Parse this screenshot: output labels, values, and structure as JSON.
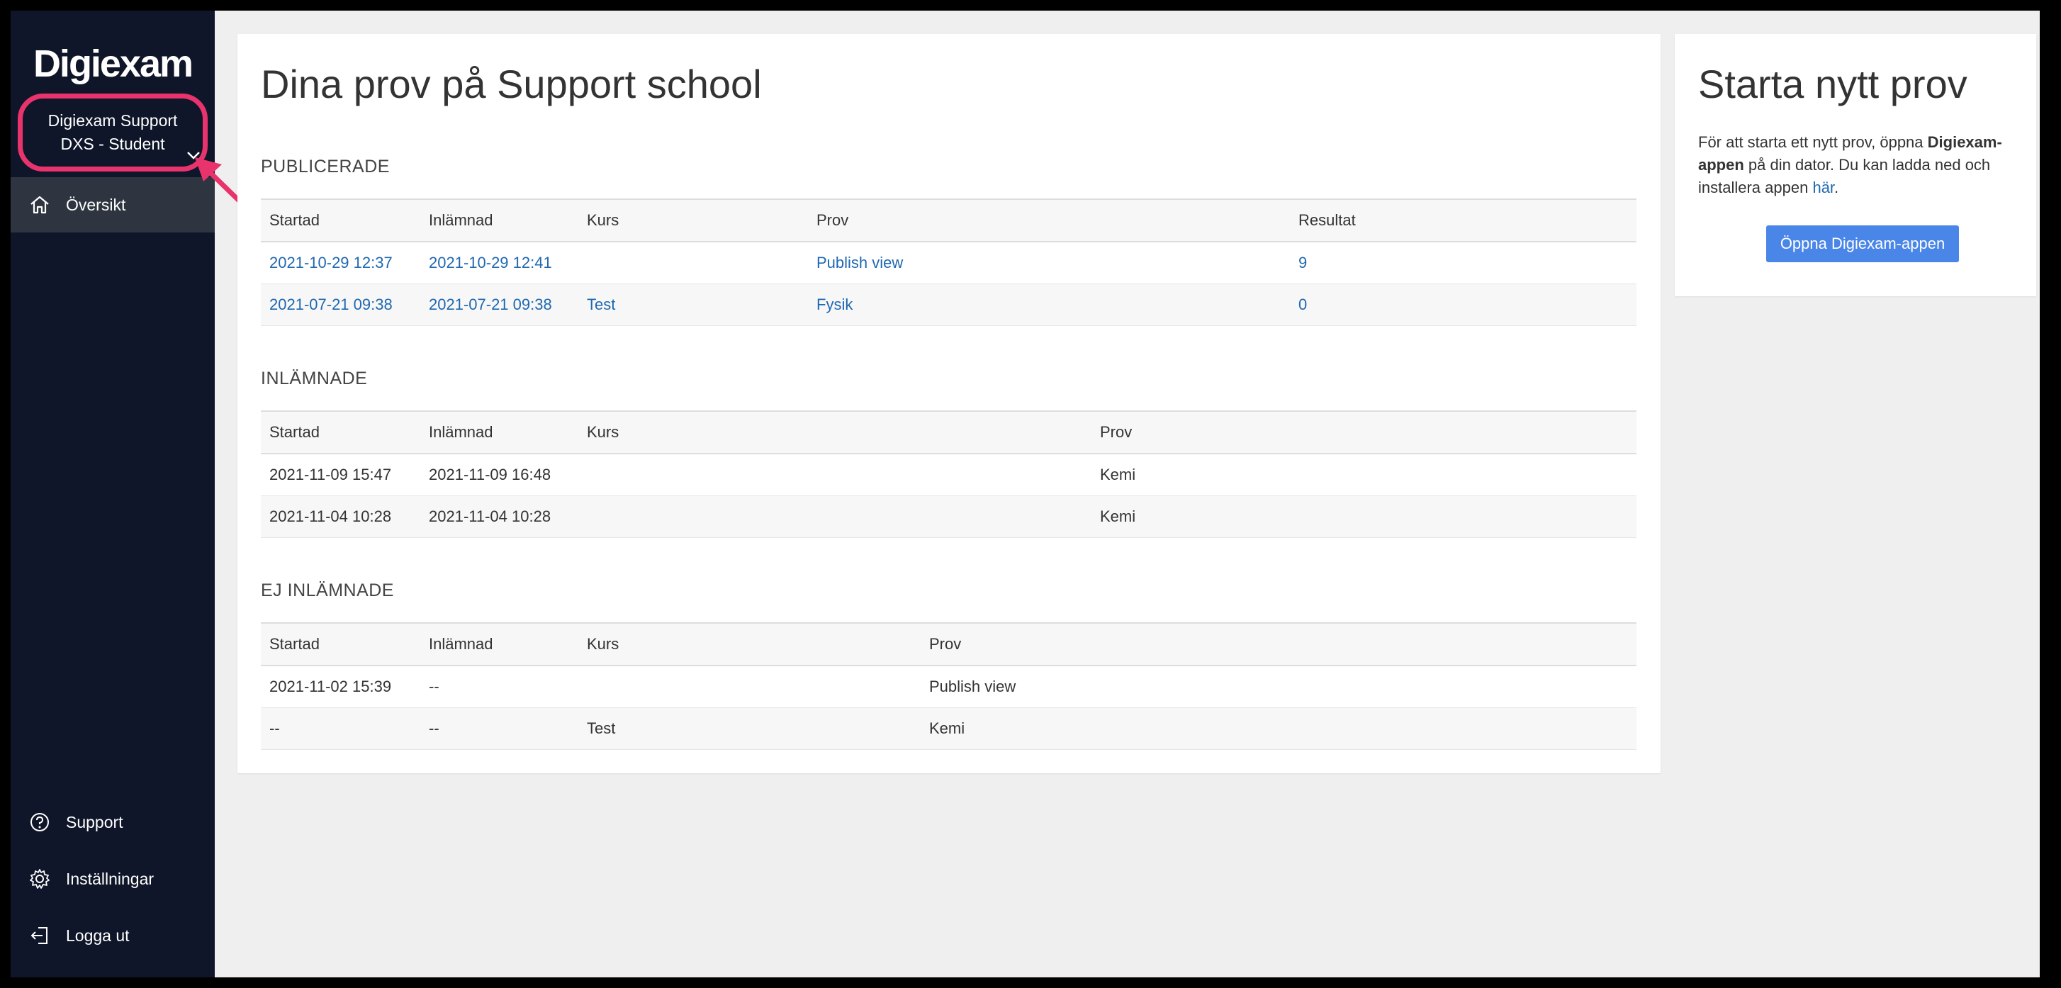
{
  "sidebar": {
    "logo": "Digiexam",
    "account": {
      "line1": "Digiexam Support",
      "line2": "DXS - Student"
    },
    "nav": [
      {
        "label": "Översikt",
        "icon": "home-icon"
      }
    ],
    "bottom": [
      {
        "label": "Support",
        "icon": "help-icon"
      },
      {
        "label": "Inställningar",
        "icon": "gear-icon"
      },
      {
        "label": "Logga ut",
        "icon": "logout-icon"
      }
    ]
  },
  "main": {
    "title": "Dina prov på Support school",
    "published": {
      "label": "PUBLICERADE",
      "headers": [
        "Startad",
        "Inlämnad",
        "Kurs",
        "Prov",
        "Resultat"
      ],
      "rows": [
        [
          "2021-10-29 12:37",
          "2021-10-29 12:41",
          "",
          "Publish view",
          "9"
        ],
        [
          "2021-07-21 09:38",
          "2021-07-21 09:38",
          "Test",
          "Fysik",
          "0"
        ]
      ]
    },
    "submitted": {
      "label": "INLÄMNADE",
      "headers": [
        "Startad",
        "Inlämnad",
        "Kurs",
        "Prov"
      ],
      "rows": [
        [
          "2021-11-09 15:47",
          "2021-11-09 16:48",
          "",
          "Kemi"
        ],
        [
          "2021-11-04 10:28",
          "2021-11-04 10:28",
          "",
          "Kemi"
        ]
      ]
    },
    "not_submitted": {
      "label": "EJ INLÄMNADE",
      "headers": [
        "Startad",
        "Inlämnad",
        "Kurs",
        "Prov"
      ],
      "rows": [
        [
          "2021-11-02 15:39",
          "--",
          "",
          "Publish view"
        ],
        [
          "--",
          "--",
          "Test",
          "Kemi"
        ]
      ]
    }
  },
  "side": {
    "title": "Starta nytt prov",
    "text_pre": "För att starta ett nytt prov, öppna ",
    "text_bold": "Digiexam-appen",
    "text_mid": " på din dator. Du kan ladda ned och installera appen ",
    "text_link": "här",
    "text_post": ".",
    "button": "Öppna Digiexam-appen"
  },
  "colors": {
    "sidebar": "#0f1629",
    "accent": "#4a86e8",
    "link": "#1f68b0",
    "highlight": "#e8336d"
  }
}
